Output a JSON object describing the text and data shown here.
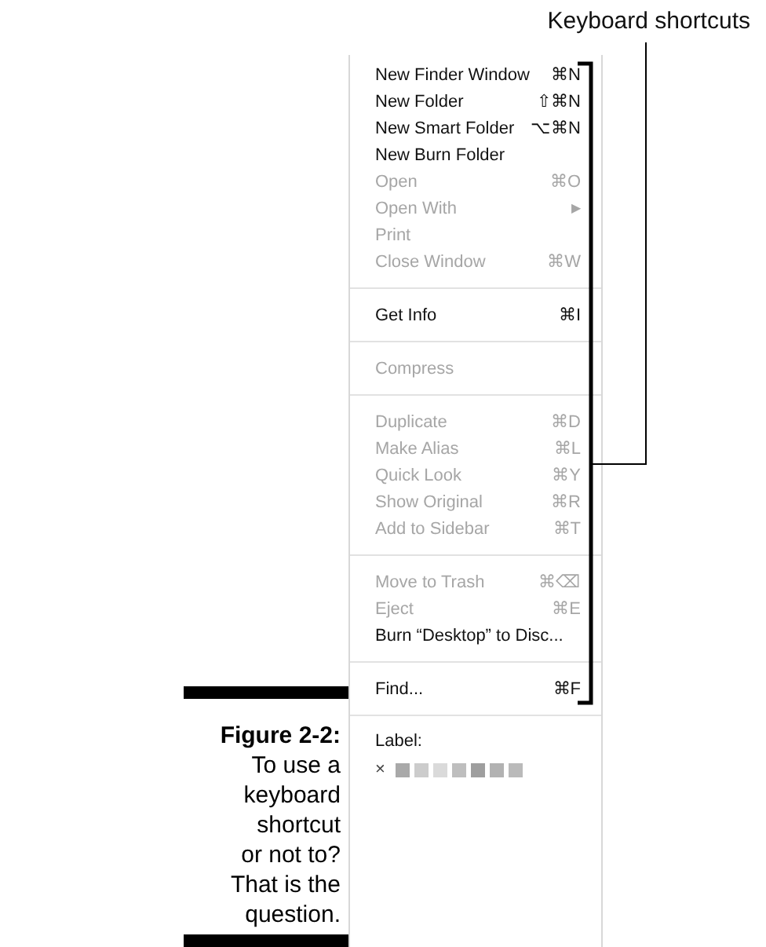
{
  "callout": {
    "label": "Keyboard shortcuts"
  },
  "caption": {
    "title": "Figure 2-2:",
    "text": "To use a\nkeyboard\nshortcut\nor not to?\nThat is the\nquestion."
  },
  "menu": {
    "groups": [
      {
        "items": [
          {
            "kind": "item",
            "label": "New Finder Window",
            "shortcut": "⌘N",
            "disabled": false
          },
          {
            "kind": "item",
            "label": "New Folder",
            "shortcut": "⇧⌘N",
            "disabled": false
          },
          {
            "kind": "item",
            "label": "New Smart Folder",
            "shortcut": "⌥⌘N",
            "disabled": false
          },
          {
            "kind": "item",
            "label": "New Burn Folder",
            "disabled": false
          },
          {
            "kind": "item",
            "label": "Open",
            "shortcut": "⌘O",
            "disabled": true
          },
          {
            "kind": "submenu",
            "label": "Open With",
            "arrow": "▶",
            "disabled": true
          },
          {
            "kind": "item",
            "label": "Print",
            "disabled": true
          },
          {
            "kind": "item",
            "label": "Close Window",
            "shortcut": "⌘W",
            "disabled": true
          }
        ]
      },
      {
        "items": [
          {
            "kind": "item",
            "label": "Get Info",
            "shortcut": "⌘I",
            "disabled": false
          }
        ]
      },
      {
        "items": [
          {
            "kind": "item",
            "label": "Compress",
            "disabled": true
          }
        ]
      },
      {
        "items": [
          {
            "kind": "item",
            "label": "Duplicate",
            "shortcut": "⌘D",
            "disabled": true
          },
          {
            "kind": "item",
            "label": "Make Alias",
            "shortcut": "⌘L",
            "disabled": true
          },
          {
            "kind": "item",
            "label": "Quick Look",
            "shortcut": "⌘Y",
            "disabled": true
          },
          {
            "kind": "item",
            "label": "Show Original",
            "shortcut": "⌘R",
            "disabled": true
          },
          {
            "kind": "item",
            "label": "Add to Sidebar",
            "shortcut": "⌘T",
            "disabled": true
          }
        ]
      },
      {
        "items": [
          {
            "kind": "item",
            "label": "Move to Trash",
            "shortcut": "⌘⌫",
            "disabled": true
          },
          {
            "kind": "item",
            "label": "Eject",
            "shortcut": "⌘E",
            "disabled": true
          },
          {
            "kind": "item",
            "label": "Burn “Desktop” to Disc...",
            "disabled": false
          }
        ]
      },
      {
        "items": [
          {
            "kind": "item",
            "label": "Find...",
            "shortcut": "⌘F",
            "disabled": false
          }
        ]
      }
    ],
    "label_section": {
      "title": "Label:",
      "clear": "×",
      "swatches": [
        {
          "color": "#a9a9a9"
        },
        {
          "color": "#cccccc"
        },
        {
          "color": "#dadada"
        },
        {
          "color": "#bebebe"
        },
        {
          "color": "#9e9e9e"
        },
        {
          "color": "#b2b2b2"
        },
        {
          "color": "#bababa"
        }
      ]
    }
  }
}
